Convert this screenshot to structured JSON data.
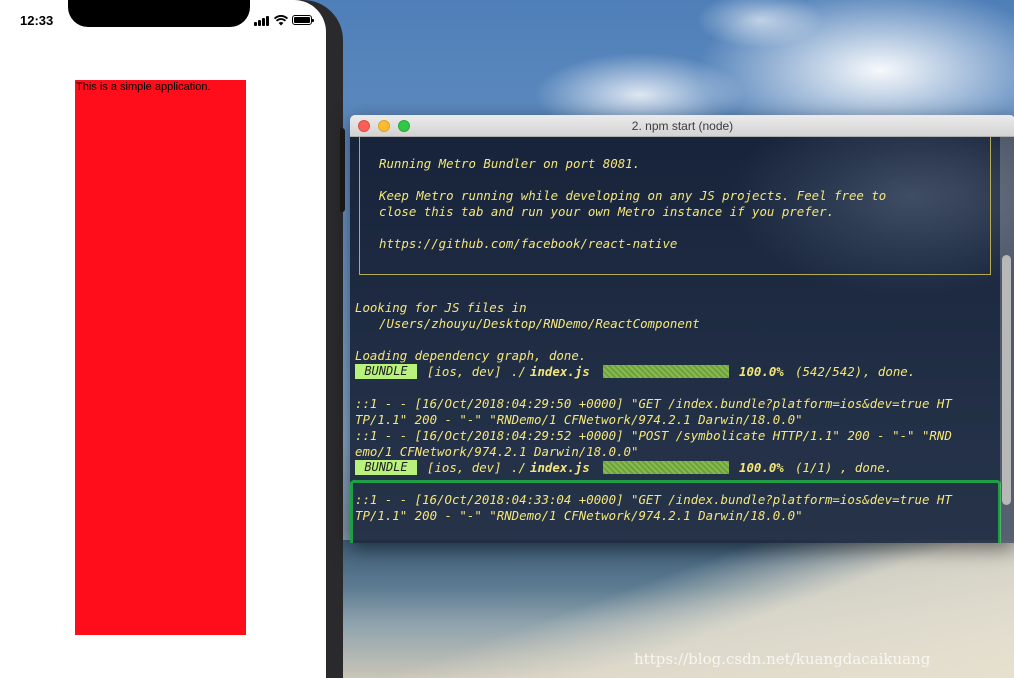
{
  "phone": {
    "status_time": "12:33",
    "app_text": "This is a simple application.",
    "red_view_color": "#ff0d1a"
  },
  "terminal": {
    "title": "2. npm start (node)",
    "banner": [
      "Running Metro Bundler on port 8081.",
      "",
      "Keep Metro running while developing on any JS projects. Feel free to",
      "close this tab and run your own Metro instance if you prefer.",
      "",
      "https://github.com/facebook/react-native"
    ],
    "looking": "Looking for JS files in",
    "path": "/Users/zhouyu/Desktop/RNDemo/ReactComponent",
    "loading": "Loading dependency graph, done.",
    "bundles": [
      {
        "badge": "BUNDLE",
        "platform": "[ios, dev]",
        "prefix": "./",
        "file": "index.js",
        "percent": "100.0%",
        "count": "(542/542)",
        "status": ", done.",
        "progress": 1.0
      },
      {
        "badge": "BUNDLE",
        "platform": "[ios, dev]",
        "prefix": "./",
        "file": "index.js",
        "percent": "100.0%",
        "count": "(1/1)",
        "status": ", done.",
        "progress": 1.0
      }
    ],
    "log1": [
      "::1 - - [16/Oct/2018:04:29:50 +0000] \"GET /index.bundle?platform=ios&dev=true HT",
      "TP/1.1\" 200 - \"-\" \"RNDemo/1 CFNetwork/974.2.1 Darwin/18.0.0\"",
      "::1 - - [16/Oct/2018:04:29:52 +0000] \"POST /symbolicate HTTP/1.1\" 200 - \"-\" \"RND",
      "emo/1 CFNetwork/974.2.1 Darwin/18.0.0\""
    ],
    "log2": [
      "::1 - - [16/Oct/2018:04:33:04 +0000] \"GET /index.bundle?platform=ios&dev=true HT",
      "TP/1.1\" 200 - \"-\" \"RNDemo/1 CFNetwork/974.2.1 Darwin/18.0.0\""
    ]
  },
  "watermark": "https://blog.csdn.net/kuangdacaikuang",
  "colors": {
    "terminal_text": "#f5e67a",
    "bundle_badge": "#b8f27d",
    "highlight_border": "#1f9e45"
  }
}
